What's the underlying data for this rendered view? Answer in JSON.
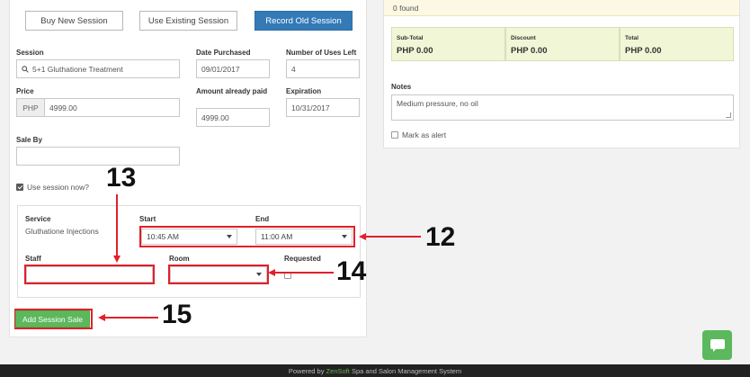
{
  "tabs": {
    "buy_new": "Buy New Session",
    "use_existing": "Use Existing Session",
    "record_old": "Record Old Session"
  },
  "form": {
    "session_label": "Session",
    "session_value": "5+1 Gluthatione Treatment",
    "date_purchased_label": "Date Purchased",
    "date_purchased_value": "09/01/2017",
    "uses_left_label": "Number of Uses Left",
    "uses_left_value": "4",
    "price_label": "Price",
    "price_currency": "PHP",
    "price_value": "4999.00",
    "amount_paid_label": "Amount already paid",
    "amount_paid_value": "4999.00",
    "expiration_label": "Expiration",
    "expiration_value": "10/31/2017",
    "sale_by_label": "Sale By",
    "sale_by_value": "",
    "use_now_label": "Use session now?",
    "use_now_checked": true
  },
  "service": {
    "service_label": "Service",
    "service_value": "Gluthatione Injections",
    "start_label": "Start",
    "start_value": "10:45 AM",
    "end_label": "End",
    "end_value": "11:00 AM",
    "staff_label": "Staff",
    "staff_value": "",
    "room_label": "Room",
    "room_value": "",
    "requested_label": "Requested",
    "requested_checked": false
  },
  "actions": {
    "add_session_sale": "Add Session Sale"
  },
  "summary": {
    "found_text": "0 found",
    "subtotal_label": "Sub-Total",
    "subtotal_value": "PHP 0.00",
    "discount_label": "Discount",
    "discount_value": "PHP 0.00",
    "total_label": "Total",
    "total_value": "PHP 0.00"
  },
  "notes": {
    "label": "Notes",
    "value": "Medium pressure, no oil",
    "mark_alert_label": "Mark as alert"
  },
  "annotations": {
    "n12": "12",
    "n13": "13",
    "n14": "14",
    "n15": "15"
  },
  "footer": {
    "prefix": "Powered by",
    "brand": "ZenSoft",
    "suffix": "Spa and Salon Management System"
  },
  "colors": {
    "primary": "#337ab7",
    "success": "#5cb85c",
    "annotation": "#e0202a"
  },
  "icons": {
    "search": "search-icon",
    "chat": "chat-icon"
  }
}
